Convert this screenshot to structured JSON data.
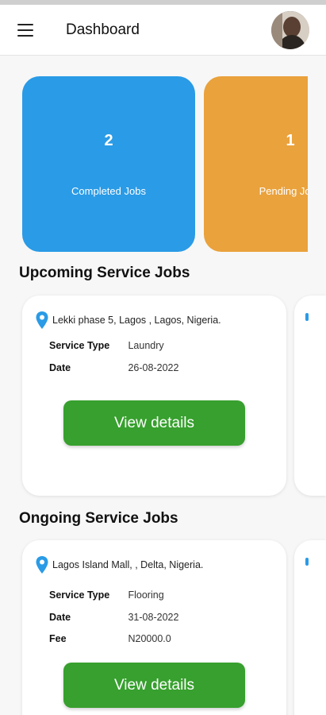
{
  "header": {
    "title": "Dashboard",
    "menu_icon": "hamburger-menu-icon",
    "avatar_icon": "user-avatar"
  },
  "stats": [
    {
      "value": "2",
      "label": "Completed Jobs",
      "color": "#2a9be6"
    },
    {
      "value": "1",
      "label": "Pending Jobs",
      "color": "#eaa23c"
    }
  ],
  "upcoming": {
    "title": "Upcoming Service Jobs",
    "job": {
      "location": "Lekki phase 5, Lagos , Lagos, Nigeria.",
      "service_type_label": "Service Type",
      "service_type": "Laundry",
      "date_label": "Date",
      "date": "26-08-2022",
      "button": "View details"
    }
  },
  "ongoing": {
    "title": "Ongoing Service Jobs",
    "job": {
      "location": "Lagos Island Mall,  , Delta, Nigeria.",
      "service_type_label": "Service Type",
      "service_type": "Flooring",
      "date_label": "Date",
      "date": "31-08-2022",
      "fee_label": "Fee",
      "fee": "N20000.0",
      "button": "View details"
    }
  },
  "colors": {
    "primary_blue": "#2a9be6",
    "pending_orange": "#eaa23c",
    "button_green": "#37a02e"
  }
}
